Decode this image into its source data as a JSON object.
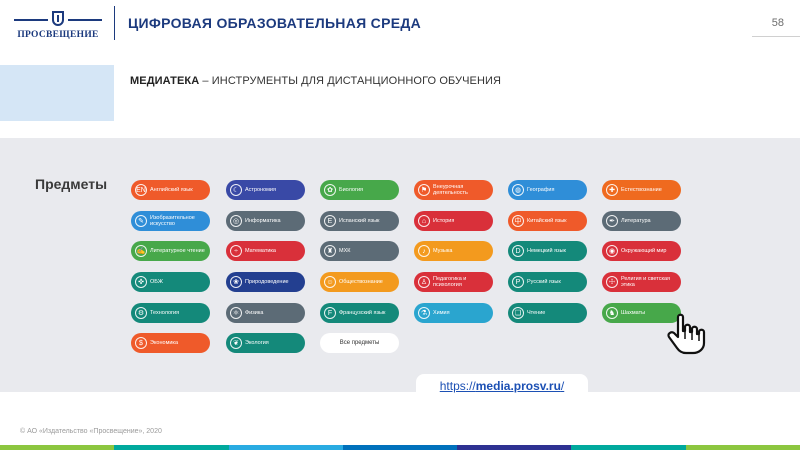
{
  "header": {
    "logo_text": "ПРОСВЕЩЕНИЕ",
    "title": "ЦИФРОВАЯ ОБРАЗОВАТЕЛЬНАЯ СРЕДА",
    "page_number": "58"
  },
  "subtitle": {
    "bold": "МЕДИАТЕКА",
    "rest": " – ИНСТРУМЕНТЫ ДЛЯ ДИСТАНЦИОННОГО ОБУЧЕНИЯ"
  },
  "panel": {
    "label": "Предметы",
    "subjects": [
      {
        "label": "Английский язык",
        "color": "#ef5a2a",
        "icon": "EN"
      },
      {
        "label": "Астрономия",
        "color": "#3949a6",
        "icon": "☾"
      },
      {
        "label": "Биология",
        "color": "#47a84a",
        "icon": "✿"
      },
      {
        "label": "Внеурочная деятельность",
        "color": "#ef5a2a",
        "icon": "⚑"
      },
      {
        "label": "География",
        "color": "#2f8ed8",
        "icon": "◍"
      },
      {
        "label": "Естествознание",
        "color": "#ef6a1f",
        "icon": "✚"
      },
      {
        "label": "Изобразительное искусство",
        "color": "#2f8ed8",
        "icon": "✎"
      },
      {
        "label": "Информатика",
        "color": "#5c6b76",
        "icon": "◎"
      },
      {
        "label": "Испанский язык",
        "color": "#5c6b76",
        "icon": "E"
      },
      {
        "label": "История",
        "color": "#d9303a",
        "icon": "⌂"
      },
      {
        "label": "Китайский язык",
        "color": "#ef5a2a",
        "icon": "中"
      },
      {
        "label": "Литература",
        "color": "#5c6b76",
        "icon": "✒"
      },
      {
        "label": "Литературное чтение",
        "color": "#47a84a",
        "icon": "✍"
      },
      {
        "label": "Математика",
        "color": "#d9303a",
        "icon": "÷"
      },
      {
        "label": "МХК",
        "color": "#5c6b76",
        "icon": "♜"
      },
      {
        "label": "Музыка",
        "color": "#f39a1e",
        "icon": "♪"
      },
      {
        "label": "Немецкий язык",
        "color": "#14897a",
        "icon": "D"
      },
      {
        "label": "Окружающий мир",
        "color": "#d9303a",
        "icon": "◉"
      },
      {
        "label": "ОБЖ",
        "color": "#14897a",
        "icon": "✜"
      },
      {
        "label": "Природоведение",
        "color": "#233f90",
        "icon": "❀"
      },
      {
        "label": "Обществознание",
        "color": "#f39a1e",
        "icon": "☺"
      },
      {
        "label": "Педагогика и психология",
        "color": "#d9303a",
        "icon": "♙"
      },
      {
        "label": "Русский язык",
        "color": "#14897a",
        "icon": "Р"
      },
      {
        "label": "Религия и светская этика",
        "color": "#d9303a",
        "icon": "☩"
      },
      {
        "label": "Технология",
        "color": "#14897a",
        "icon": "⚙"
      },
      {
        "label": "Физика",
        "color": "#5c6b76",
        "icon": "⚛"
      },
      {
        "label": "Французский язык",
        "color": "#14897a",
        "icon": "F"
      },
      {
        "label": "Химия",
        "color": "#2aa5cf",
        "icon": "⚗"
      },
      {
        "label": "Чтение",
        "color": "#14897a",
        "icon": "❏"
      },
      {
        "label": "Шахматы",
        "color": "#47a84a",
        "icon": "♞"
      },
      {
        "label": "Экономика",
        "color": "#ef5a2a",
        "icon": "$"
      },
      {
        "label": "Экология",
        "color": "#14897a",
        "icon": "❦"
      },
      {
        "label": "Все предметы",
        "color": "#ffffff",
        "icon": ""
      }
    ],
    "link": {
      "prefix": "https://",
      "bold": "media.prosv.ru",
      "suffix": "/"
    }
  },
  "footer": {
    "copyright": "© АО «Издательство «Просвещение», 2020"
  },
  "stripe_colors": [
    "#8cc63f",
    "#00a99d",
    "#29abe2",
    "#0071bc",
    "#2e3192",
    "#00a99d",
    "#8cc63f"
  ]
}
